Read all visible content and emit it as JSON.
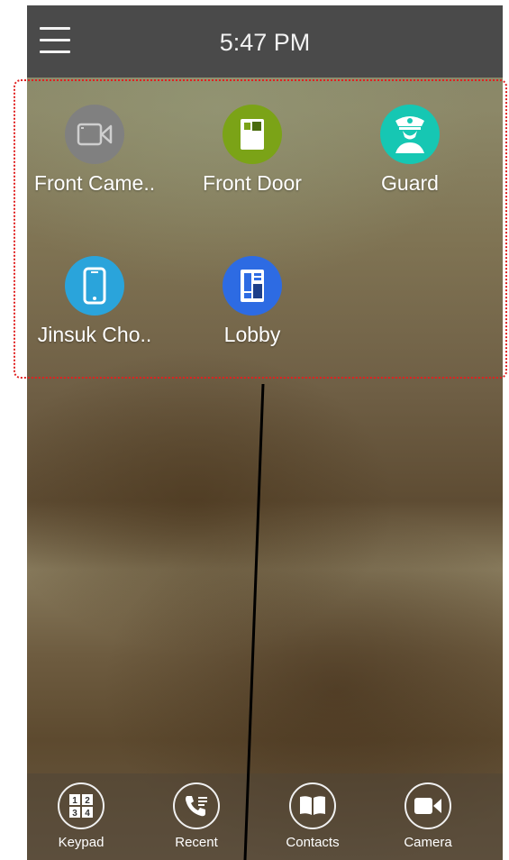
{
  "status_bar": {
    "time": "5:47 PM"
  },
  "favorites": [
    {
      "label": "Front Came..",
      "icon": "video-camera-icon",
      "color": "#808080"
    },
    {
      "label": "Front Door",
      "icon": "door-station-icon",
      "color": "#7ba317"
    },
    {
      "label": "Guard",
      "icon": "guard-icon",
      "color": "#16c7b3"
    },
    {
      "label": "Jinsuk Cho..",
      "icon": "smartphone-icon",
      "color": "#2aa4db"
    },
    {
      "label": "Lobby",
      "icon": "lobby-panel-icon",
      "color": "#2d6be3"
    }
  ],
  "tabs": [
    {
      "label": "Keypad",
      "icon": "keypad-icon",
      "keys": [
        "1",
        "2",
        "3",
        "4"
      ]
    },
    {
      "label": "Recent",
      "icon": "recent-calls-icon"
    },
    {
      "label": "Contacts",
      "icon": "contacts-book-icon"
    },
    {
      "label": "Camera",
      "icon": "video-camera-icon"
    }
  ],
  "annotation": {
    "frame_color": "#e02020",
    "line_color": "#000000"
  }
}
